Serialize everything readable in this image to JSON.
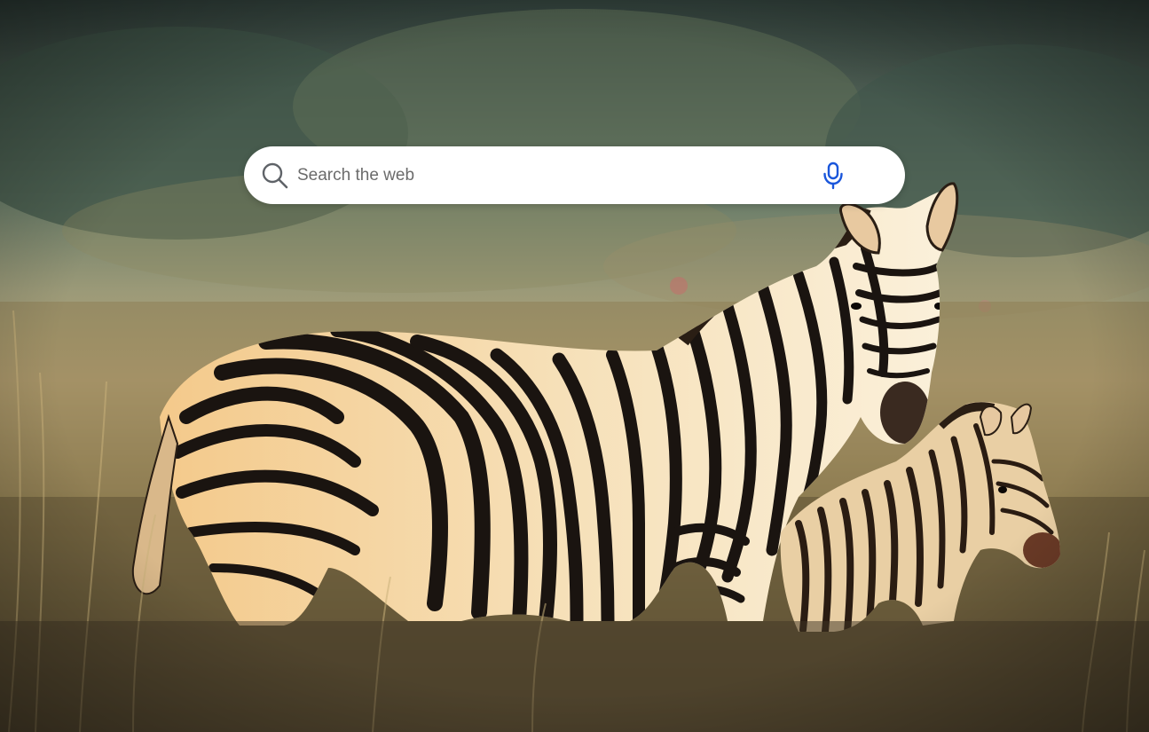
{
  "search": {
    "placeholder": "Search the web",
    "value": ""
  },
  "icons": {
    "search": "search-icon",
    "microphone": "microphone-icon"
  },
  "colors": {
    "accent": "#1a56db",
    "search_box_background": "#ffffff",
    "placeholder_text": "#6b6b6b"
  }
}
